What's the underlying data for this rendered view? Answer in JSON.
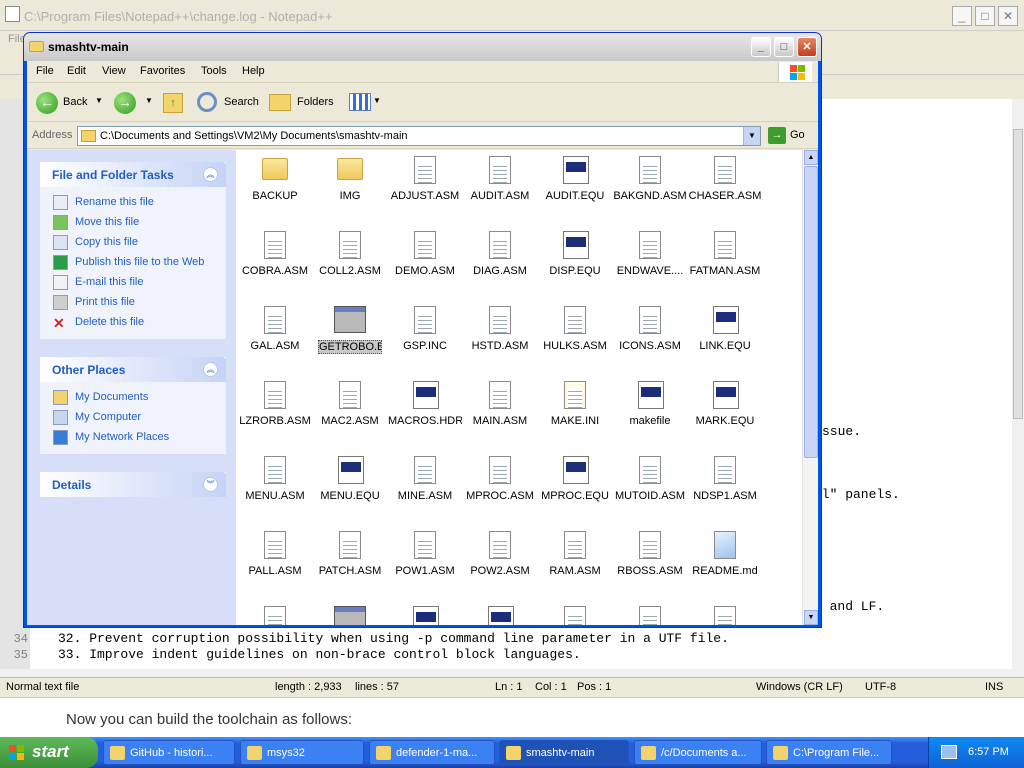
{
  "notepad": {
    "title": "C:\\Program Files\\Notepad++\\change.log - Notepad++",
    "menu_first": "File",
    "frag_lines": [
      {
        "text": "ssue."
      },
      {
        "text": "el\" panels."
      },
      {
        "text": "R and LF."
      }
    ],
    "lines": [
      {
        "num": "34",
        "text": "32. Prevent corruption possibility when using -p command line parameter in a UTF file."
      },
      {
        "num": "35",
        "text": "33. Improve indent guidelines on non-brace control block languages."
      }
    ],
    "status": {
      "type": "Normal text file",
      "length": "length : 2,933",
      "lines": "lines : 57",
      "ln": "Ln : 1",
      "col": "Col : 1",
      "pos": "Pos : 1",
      "eol": "Windows (CR LF)",
      "enc": "UTF-8",
      "ins": "INS"
    },
    "below_text": "Now you can build the toolchain as follows:"
  },
  "explorer": {
    "title": "smashtv-main",
    "menu": [
      "File",
      "Edit",
      "View",
      "Favorites",
      "Tools",
      "Help"
    ],
    "toolbar": {
      "back": "Back",
      "search": "Search",
      "folders": "Folders"
    },
    "address_label": "Address",
    "address": "C:\\Documents and Settings\\VM2\\My Documents\\smashtv-main",
    "go": "Go",
    "tasks": {
      "title": "File and Folder Tasks",
      "items": [
        "Rename this file",
        "Move this file",
        "Copy this file",
        "Publish this file to the Web",
        "E-mail this file",
        "Print this file",
        "Delete this file"
      ]
    },
    "places": {
      "title": "Other Places",
      "items": [
        "My Documents",
        "My Computer",
        "My Network Places"
      ]
    },
    "details": {
      "title": "Details"
    },
    "files": [
      {
        "name": "BACKUP",
        "kind": "folder"
      },
      {
        "name": "IMG",
        "kind": "folder"
      },
      {
        "name": "ADJUST.ASM",
        "kind": "text"
      },
      {
        "name": "AUDIT.ASM",
        "kind": "text"
      },
      {
        "name": "AUDIT.EQU",
        "kind": "win"
      },
      {
        "name": "BAKGND.ASM",
        "kind": "text"
      },
      {
        "name": "CHASER.ASM",
        "kind": "text"
      },
      {
        "name": "COBRA.ASM",
        "kind": "text"
      },
      {
        "name": "COLL2.ASM",
        "kind": "text"
      },
      {
        "name": "DEMO.ASM",
        "kind": "text"
      },
      {
        "name": "DIAG.ASM",
        "kind": "text"
      },
      {
        "name": "DISP.EQU",
        "kind": "win"
      },
      {
        "name": "ENDWAVE....",
        "kind": "text"
      },
      {
        "name": "FATMAN.ASM",
        "kind": "text"
      },
      {
        "name": "GAL.ASM",
        "kind": "text"
      },
      {
        "name": "GETROBO.BAT",
        "kind": "bat",
        "selected": true
      },
      {
        "name": "GSP.INC",
        "kind": "text"
      },
      {
        "name": "HSTD.ASM",
        "kind": "text"
      },
      {
        "name": "HULKS.ASM",
        "kind": "text"
      },
      {
        "name": "ICONS.ASM",
        "kind": "text"
      },
      {
        "name": "LINK.EQU",
        "kind": "win"
      },
      {
        "name": "LZRORB.ASM",
        "kind": "text"
      },
      {
        "name": "MAC2.ASM",
        "kind": "text"
      },
      {
        "name": "MACROS.HDR",
        "kind": "win"
      },
      {
        "name": "MAIN.ASM",
        "kind": "text"
      },
      {
        "name": "MAKE.INI",
        "kind": "ini"
      },
      {
        "name": "makefile",
        "kind": "win"
      },
      {
        "name": "MARK.EQU",
        "kind": "win"
      },
      {
        "name": "MENU.ASM",
        "kind": "text"
      },
      {
        "name": "MENU.EQU",
        "kind": "win"
      },
      {
        "name": "MINE.ASM",
        "kind": "text"
      },
      {
        "name": "MPROC.ASM",
        "kind": "text"
      },
      {
        "name": "MPROC.EQU",
        "kind": "win"
      },
      {
        "name": "MUTOID.ASM",
        "kind": "text"
      },
      {
        "name": "NDSP1.ASM",
        "kind": "text"
      },
      {
        "name": "PALL.ASM",
        "kind": "text"
      },
      {
        "name": "PATCH.ASM",
        "kind": "text"
      },
      {
        "name": "POW1.ASM",
        "kind": "text"
      },
      {
        "name": "POW2.ASM",
        "kind": "text"
      },
      {
        "name": "RAM.ASM",
        "kind": "text"
      },
      {
        "name": "RBOSS.ASM",
        "kind": "text"
      },
      {
        "name": "README.md",
        "kind": "md"
      },
      {
        "name": "",
        "kind": "text"
      },
      {
        "name": "",
        "kind": "bat"
      },
      {
        "name": "",
        "kind": "win"
      },
      {
        "name": "",
        "kind": "win"
      },
      {
        "name": "",
        "kind": "text"
      },
      {
        "name": "",
        "kind": "text"
      },
      {
        "name": "",
        "kind": "text"
      }
    ]
  },
  "taskbar": {
    "start": "start",
    "items": [
      {
        "label": "GitHub - histori..."
      },
      {
        "label": "msys32"
      },
      {
        "label": "defender-1-ma..."
      },
      {
        "label": "smashtv-main",
        "active": true
      },
      {
        "label": "/c/Documents a..."
      },
      {
        "label": "C:\\Program File..."
      }
    ],
    "clock": "6:57 PM"
  }
}
